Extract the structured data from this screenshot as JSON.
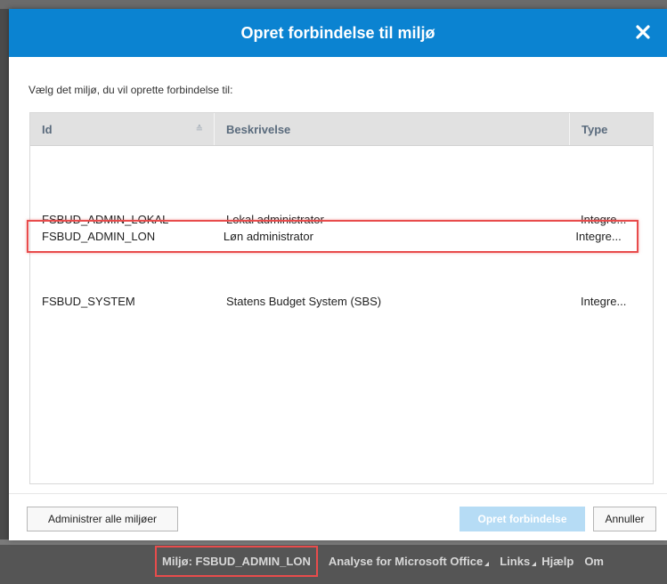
{
  "dialog": {
    "title": "Opret forbindelse til miljø",
    "instruction": "Vælg det miljø, du vil oprette forbindelse til:",
    "table": {
      "columns": [
        "Id",
        "Beskrivelse",
        "Type"
      ],
      "rows": [
        {
          "id": "FSBUD_ADMIN_LOKAL",
          "description": "Lokal administrator",
          "type": "Integre..."
        },
        {
          "id": "FSBUD_ADMIN_LON",
          "description": "Løn administrator",
          "type": "Integre..."
        },
        {
          "id": "FSBUD_SYSTEM",
          "description": "Statens Budget System (SBS)",
          "type": "Integre..."
        }
      ],
      "selected_row": 1
    },
    "footer": {
      "manage_label": "Administrer alle miljøer",
      "connect_label": "Opret forbindelse",
      "cancel_label": "Annuller"
    }
  },
  "status_bar": {
    "environment": "Miljø: FSBUD_ADMIN_LON",
    "menu_items": [
      "Analyse for Microsoft Office",
      "Links",
      "Hjælp",
      "Om"
    ]
  },
  "colors": {
    "header_blue": "#0b83d1",
    "highlight_red": "#e84c4c",
    "disabled_button": "#b6dcf5"
  }
}
